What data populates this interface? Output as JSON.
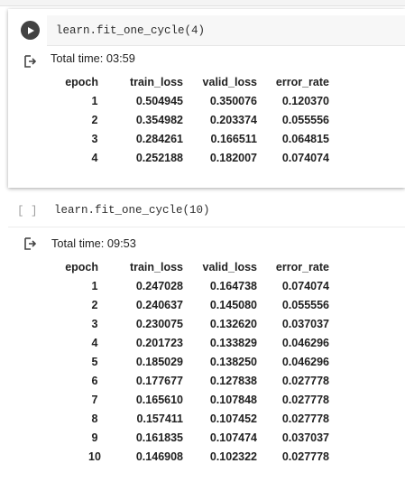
{
  "cells": [
    {
      "code": "learn.fit_one_cycle(4)",
      "total_time": "Total time: 03:59",
      "columns": [
        "epoch",
        "train_loss",
        "valid_loss",
        "error_rate"
      ],
      "rows": [
        [
          "1",
          "0.504945",
          "0.350076",
          "0.120370"
        ],
        [
          "2",
          "0.354982",
          "0.203374",
          "0.055556"
        ],
        [
          "3",
          "0.284261",
          "0.166511",
          "0.064815"
        ],
        [
          "4",
          "0.252188",
          "0.182007",
          "0.074074"
        ]
      ]
    },
    {
      "execution_marker": "[ ]",
      "code": "learn.fit_one_cycle(10)",
      "total_time": "Total time: 09:53",
      "columns": [
        "epoch",
        "train_loss",
        "valid_loss",
        "error_rate"
      ],
      "rows": [
        [
          "1",
          "0.247028",
          "0.164738",
          "0.074074"
        ],
        [
          "2",
          "0.240637",
          "0.145080",
          "0.055556"
        ],
        [
          "3",
          "0.230075",
          "0.132620",
          "0.037037"
        ],
        [
          "4",
          "0.201723",
          "0.133829",
          "0.046296"
        ],
        [
          "5",
          "0.185029",
          "0.138250",
          "0.046296"
        ],
        [
          "6",
          "0.177677",
          "0.127838",
          "0.027778"
        ],
        [
          "7",
          "0.165610",
          "0.107848",
          "0.027778"
        ],
        [
          "8",
          "0.157411",
          "0.107452",
          "0.027778"
        ],
        [
          "9",
          "0.161835",
          "0.107474",
          "0.037037"
        ],
        [
          "10",
          "0.146908",
          "0.102322",
          "0.027778"
        ]
      ]
    }
  ],
  "icons": {
    "run": "play-circle-icon",
    "output": "output-arrow-icon"
  },
  "colors": {
    "run_button": "#424242",
    "code_bg": "#f7f7f7",
    "text": "#212121"
  }
}
